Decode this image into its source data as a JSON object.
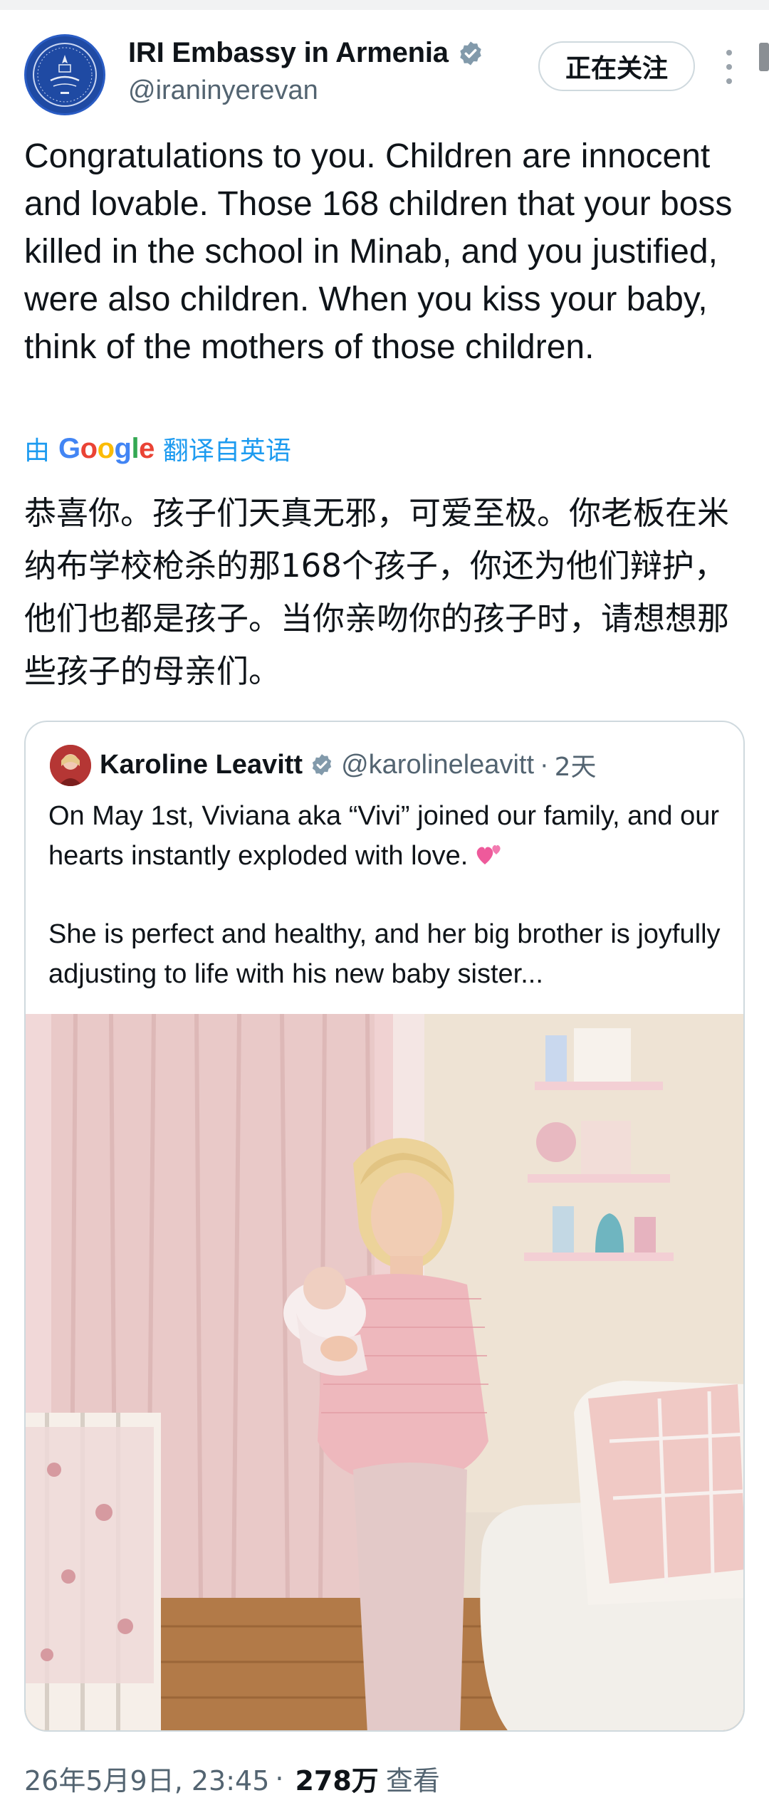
{
  "author": {
    "name": "IRI Embassy in Armenia",
    "handle": "@iraninyerevan",
    "follow_label": "正在关注"
  },
  "tweet": {
    "text": "Congratulations to you. Children are innocent and lovable. Those 168 children that your boss killed in the school in Minab, and you justified, were also children. When you kiss your baby, think of the mothers of those children.",
    "translate_prefix": "由",
    "translate_brand": "Google",
    "translate_suffix": "翻译自英语",
    "translated_text": "恭喜你。孩子们天真无邪，可爱至极。你老板在米纳布学校枪杀的那168个孩子，你还为他们辩护，他们也都是孩子。当你亲吻你的孩子时，请想想那些孩子的母亲们。"
  },
  "quoted": {
    "name": "Karoline Leavitt",
    "handle": "@karolineleavitt",
    "separator": "·",
    "time": "2天",
    "paragraph1": "On May 1st, Viviana aka “Vivi” joined our family, and our hearts instantly exploded with love.",
    "paragraph2": "She is perfect and healthy, and her big brother is joyfully adjusting to life with his new baby sister..."
  },
  "footer": {
    "timestamp": "26年5月9日, 23:45",
    "separator": "·",
    "views": "278万",
    "views_label": "查看"
  },
  "colors": {
    "link": "#1d9bf0",
    "verified": "#829aab",
    "secondary_text": "#536471"
  }
}
